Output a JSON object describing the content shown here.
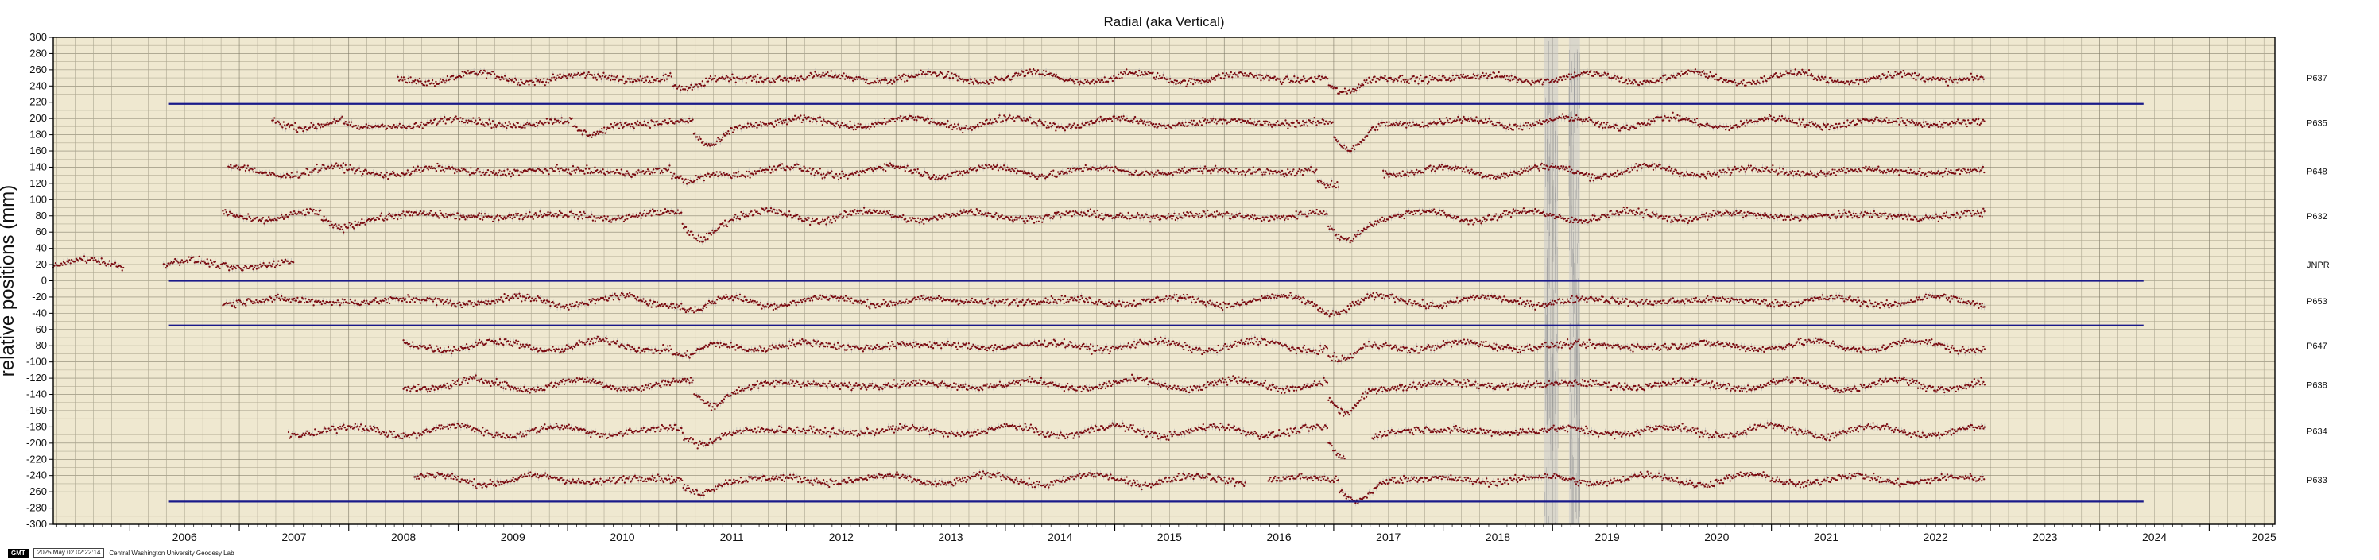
{
  "chart_data": {
    "type": "scatter",
    "title": "Radial (aka Vertical)",
    "ylabel": "relative positions (mm)",
    "xlabel": "",
    "ylim": [
      -300,
      300
    ],
    "xlim": [
      2005.3,
      2025.6
    ],
    "yticks": [
      -300,
      -280,
      -260,
      -240,
      -220,
      -200,
      -180,
      -160,
      -140,
      -120,
      -100,
      -80,
      -60,
      -40,
      -20,
      0,
      20,
      40,
      60,
      80,
      100,
      120,
      140,
      160,
      180,
      200,
      220,
      240,
      260,
      280,
      300
    ],
    "xtick_years": [
      "2006",
      "2007",
      "2008",
      "2009",
      "2010",
      "2011",
      "2012",
      "2013",
      "2014",
      "2015",
      "2016",
      "2017",
      "2018",
      "2019",
      "2020",
      "2021",
      "2022",
      "2023",
      "2024",
      "2025"
    ],
    "grid": true,
    "background": "#efe8d0",
    "point_color": "#7a0a10",
    "errorbar_color": "#b9b9b9",
    "reference_line_color": "#1a1a8a",
    "series": [
      {
        "name": "P637",
        "offset": 250,
        "start": 2008.45,
        "end": 2022.95,
        "gaps": [],
        "dips": [
          [
            2011.1,
            -15
          ],
          [
            2017.1,
            -20
          ]
        ]
      },
      {
        "name": "P635",
        "offset": 195,
        "start": 2007.3,
        "end": 2022.95,
        "gaps": [],
        "dips": [
          [
            2008.1,
            -12
          ],
          [
            2010.2,
            -15
          ],
          [
            2011.3,
            -30
          ],
          [
            2017.15,
            -35
          ]
        ]
      },
      {
        "name": "P648",
        "offset": 135,
        "start": 2006.9,
        "end": 2022.95,
        "gaps": [
          [
            2017.05,
            2017.45
          ]
        ],
        "dips": [
          [
            2011.1,
            -15
          ],
          [
            2017.0,
            -20
          ]
        ]
      },
      {
        "name": "P632",
        "offset": 80,
        "start": 2006.85,
        "end": 2022.95,
        "gaps": [],
        "dips": [
          [
            2007.9,
            -15
          ],
          [
            2011.2,
            -25
          ],
          [
            2017.1,
            -30
          ]
        ]
      },
      {
        "name": "JNPR",
        "offset": 20,
        "start": 2005.3,
        "end": 2007.5,
        "gaps": [
          [
            2005.95,
            2006.3
          ]
        ],
        "dips": []
      },
      {
        "name": "P653",
        "offset": -25,
        "start": 2006.85,
        "end": 2022.95,
        "gaps": [],
        "dips": [
          [
            2011.2,
            -10
          ],
          [
            2017.0,
            -10
          ]
        ]
      },
      {
        "name": "P647",
        "offset": -80,
        "start": 2008.5,
        "end": 2022.95,
        "gaps": [],
        "dips": [
          [
            2011.1,
            -15
          ],
          [
            2017.1,
            -20
          ]
        ]
      },
      {
        "name": "P638",
        "offset": -128,
        "start": 2008.5,
        "end": 2022.95,
        "gaps": [],
        "dips": [
          [
            2011.3,
            -25
          ],
          [
            2017.1,
            -40
          ]
        ]
      },
      {
        "name": "P634",
        "offset": -185,
        "start": 2007.45,
        "end": 2022.95,
        "gaps": [
          [
            2017.1,
            2017.35
          ]
        ],
        "dips": [
          [
            2011.2,
            -15
          ],
          [
            2017.1,
            -35
          ]
        ]
      },
      {
        "name": "P633",
        "offset": -245,
        "start": 2008.6,
        "end": 2022.95,
        "gaps": [
          [
            2016.2,
            2016.4
          ]
        ],
        "dips": [
          [
            2011.2,
            -15
          ],
          [
            2017.2,
            -25
          ]
        ]
      }
    ],
    "reference_lines": [
      {
        "y": 218,
        "x0": 2006.35,
        "x1": 2024.4
      },
      {
        "y": 0,
        "x0": 2006.35,
        "x1": 2024.4
      },
      {
        "y": -55,
        "x0": 2006.35,
        "x1": 2024.4
      },
      {
        "y": -272,
        "x0": 2006.35,
        "x1": 2024.4
      }
    ],
    "noise_bands": [
      {
        "x0": 2018.92,
        "x1": 2019.05
      },
      {
        "x0": 2019.15,
        "x1": 2019.25
      }
    ]
  },
  "footer": {
    "logo": "GMT",
    "timestamp": "2025 May 02 02:22:14",
    "lab": "Central Washington University Geodesy Lab"
  }
}
